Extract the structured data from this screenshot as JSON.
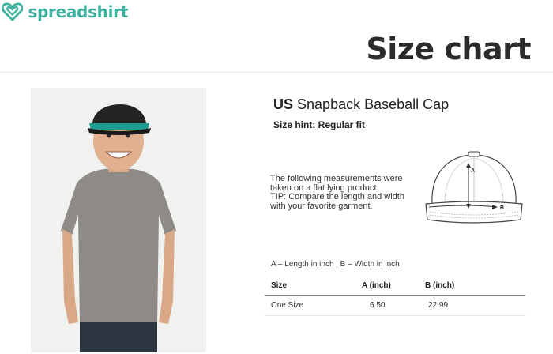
{
  "brand": {
    "name": "spreadshirt",
    "color": "#3db1a0"
  },
  "header": {
    "title": "Size chart"
  },
  "product": {
    "region": "US",
    "name": "Snapback Baseball Cap",
    "size_hint": "Size hint: Regular fit",
    "note_lines": [
      "The following measurements were",
      "taken on a flat lying product.",
      "TIP: Compare the length and width",
      "with your favorite garment."
    ]
  },
  "diagram": {
    "label_a": "A",
    "label_b": "B"
  },
  "legend": "A – Length in inch | B – Width in inch",
  "size_table": {
    "headers": [
      "Size",
      "A (inch)",
      "B (inch)"
    ],
    "rows": [
      [
        "One Size",
        "6.50",
        "22.99"
      ]
    ]
  }
}
